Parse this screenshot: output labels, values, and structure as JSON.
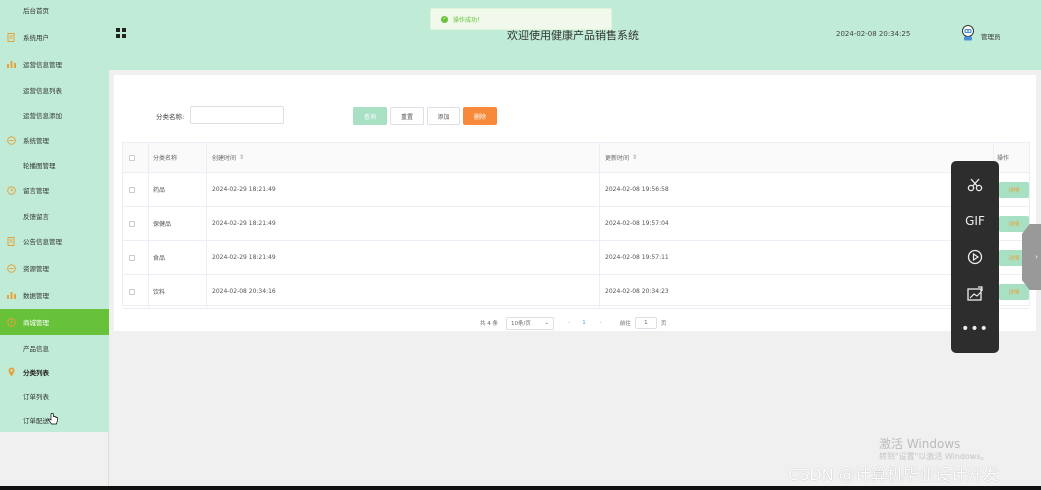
{
  "sidebar": {
    "items": [
      {
        "label": "后台首页",
        "type": "sub",
        "icon": "none"
      },
      {
        "label": "系统用户",
        "type": "main",
        "icon": "doc-icon"
      },
      {
        "label": "运营信息管理",
        "type": "main",
        "icon": "chart-icon"
      },
      {
        "label": "运营信息列表",
        "type": "sub",
        "icon": "none"
      },
      {
        "label": "运营信息添加",
        "type": "sub",
        "icon": "none"
      },
      {
        "label": "系统管理",
        "type": "main",
        "icon": "chat-icon"
      },
      {
        "label": "轮播图管理",
        "type": "sub",
        "icon": "none"
      },
      {
        "label": "留言管理",
        "type": "main",
        "icon": "clock-icon"
      },
      {
        "label": "反馈留言",
        "type": "sub",
        "icon": "none"
      },
      {
        "label": "公告信息管理",
        "type": "main",
        "icon": "doc-icon"
      },
      {
        "label": "资源管理",
        "type": "main",
        "icon": "chat-icon"
      },
      {
        "label": "数据管理",
        "type": "main",
        "icon": "chart-icon"
      },
      {
        "label": "商城管理",
        "type": "main",
        "icon": "clock-icon",
        "active": true
      },
      {
        "label": "产品信息",
        "type": "sub",
        "icon": "none"
      },
      {
        "label": "分类列表",
        "type": "main",
        "icon": "pin-icon",
        "bold": true
      },
      {
        "label": "订单列表",
        "type": "sub",
        "icon": "none"
      },
      {
        "label": "订单配送",
        "type": "sub",
        "icon": "none"
      }
    ]
  },
  "header": {
    "title": "欢迎使用健康产品销售系统",
    "datetime": "2024-02-08 20:34:25",
    "admin": "管理员"
  },
  "toast": {
    "message": "操作成功！"
  },
  "search": {
    "label": "分类名称:",
    "value": "",
    "buttons": {
      "query": "查询",
      "reset": "重置",
      "add": "添加",
      "delete": "删除"
    }
  },
  "table": {
    "headers": {
      "name": "分类名称",
      "created": "创建时间",
      "updated": "更新时间",
      "actions": "操作"
    },
    "rows": [
      {
        "name": "药品",
        "created": "2024-02-29 18:21:49",
        "updated": "2024-02-08 19:56:58",
        "action": "详情"
      },
      {
        "name": "保健品",
        "created": "2024-02-29 18:21:49",
        "updated": "2024-02-08 19:57:04",
        "action": "详情"
      },
      {
        "name": "食品",
        "created": "2024-02-29 18:21:49",
        "updated": "2024-02-08 19:57:11",
        "action": "详情"
      },
      {
        "name": "饮料",
        "created": "2024-02-08 20:34:16",
        "updated": "2024-02-08 20:34:23",
        "action": "详情"
      }
    ]
  },
  "pagination": {
    "total": "共 4 条",
    "page_size": "10条/页",
    "current": "1",
    "goto_prefix": "前往",
    "goto_value": "1",
    "goto_suffix": "页"
  },
  "floating_toolbar": {
    "gif_label": "GIF"
  },
  "overlay": {
    "watermark_line1": "激活 Windows",
    "watermark_line2": "转到\"设置\"以激活 Windows。",
    "csdn": "CSDN @计算机毕业设计开发"
  },
  "colors": {
    "sidebar_bg": "#c0ecd7",
    "active_nav": "#67c23a",
    "delete_btn": "#f7893a",
    "query_btn": "#a8e0c4"
  }
}
